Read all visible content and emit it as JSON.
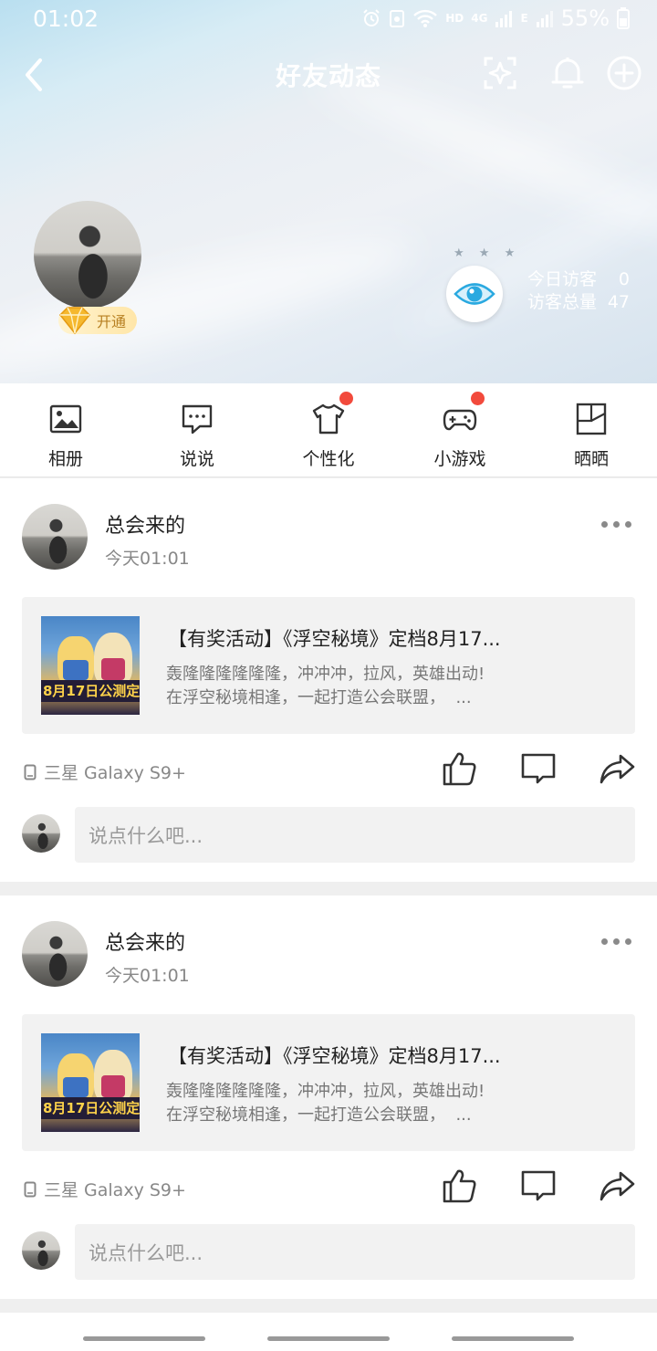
{
  "status_bar": {
    "time": "01:02",
    "network_hd": "HD",
    "network_4g": "4G",
    "network_e": "E",
    "battery": "55%"
  },
  "navbar": {
    "title": "好友动态"
  },
  "profile": {
    "vip_badge": "开通",
    "stars": "★ ★ ★",
    "visitors_today_label": "今日访客",
    "visitors_today": "0",
    "visitors_total_label": "访客总量",
    "visitors_total": "47"
  },
  "shortcuts": [
    {
      "label": "相册",
      "icon": "photo-album-icon",
      "has_dot": false
    },
    {
      "label": "说说",
      "icon": "chat-bubble-icon",
      "has_dot": false
    },
    {
      "label": "个性化",
      "icon": "tshirt-icon",
      "has_dot": true
    },
    {
      "label": "小游戏",
      "icon": "gamepad-icon",
      "has_dot": true
    },
    {
      "label": "晒晒",
      "icon": "share-frame-icon",
      "has_dot": false
    }
  ],
  "posts": [
    {
      "author": "总会来的",
      "time": "今天01:01",
      "share_title": "【有奖活动】《浮空秘境》定档8月17...",
      "share_desc": "轰隆隆隆隆隆隆，冲冲冲，拉风，英雄出动!\n在浮空秘境相逢，一起打造公会联盟，  ...",
      "thumb_text": "8月17日公测定档",
      "device": "三星 Galaxy S9+",
      "comment_placeholder": "说点什么吧..."
    },
    {
      "author": "总会来的",
      "time": "今天01:01",
      "share_title": "【有奖活动】《浮空秘境》定档8月17...",
      "share_desc": "轰隆隆隆隆隆隆，冲冲冲，拉风，英雄出动!\n在浮空秘境相逢，一起打造公会联盟，  ...",
      "thumb_text": "8月17日公测定档",
      "device": "三星 Galaxy S9+",
      "comment_placeholder": "说点什么吧..."
    }
  ],
  "colors": {
    "accent_red": "#f24a3c",
    "eye_blue": "#2aa9e0",
    "vip_gold": "#f5b82e"
  }
}
